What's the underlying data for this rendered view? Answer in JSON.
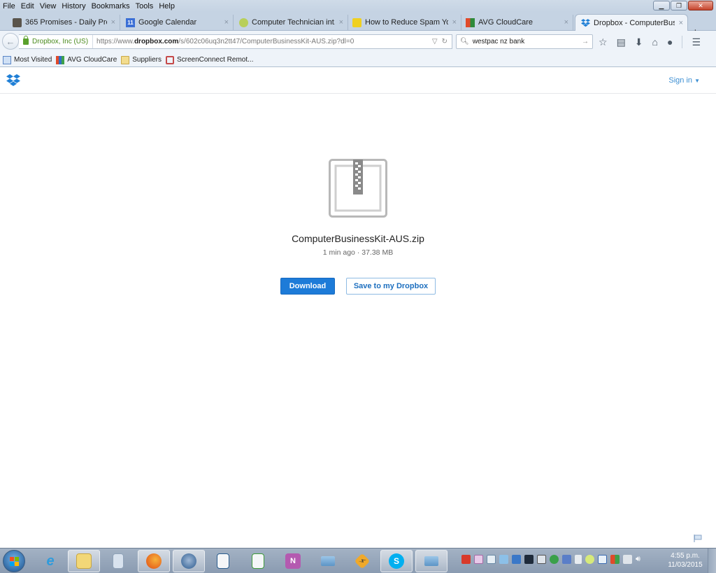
{
  "menubar": {
    "items": [
      "File",
      "Edit",
      "View",
      "History",
      "Bookmarks",
      "Tools",
      "Help"
    ]
  },
  "window_controls": {
    "minimize": "minimize-icon",
    "restore": "restore-icon",
    "close": "close-icon"
  },
  "tabs": [
    {
      "label": "365 Promises - Daily Pro...",
      "icon": "box-icon",
      "active": false
    },
    {
      "label": "Google Calendar",
      "icon": "calendar-icon",
      "icon_text": "11",
      "active": false
    },
    {
      "label": "Computer Technician int...",
      "icon": "mug-icon",
      "active": false
    },
    {
      "label": "How to Reduce Spam Yo...",
      "icon": "cartoon-icon",
      "active": false
    },
    {
      "label": "AVG CloudCare",
      "icon": "avg-icon",
      "active": false
    },
    {
      "label": "Dropbox - ComputerBusi...",
      "icon": "dropbox-icon",
      "active": true
    }
  ],
  "newtab_label": "+",
  "tab_close_glyph": "×",
  "navbar": {
    "identity": "Dropbox, Inc (US)",
    "url_prefix": "https://www.",
    "url_domain": "dropbox.com",
    "url_path": "/s/602c06uq3n2tt47/ComputerBusinessKit-AUS.zip?dl=0",
    "search_value": "westpac nz bank"
  },
  "bookmarks": [
    {
      "label": "Most Visited",
      "icon": "most-visited-icon"
    },
    {
      "label": "AVG CloudCare",
      "icon": "avg-icon"
    },
    {
      "label": "Suppliers",
      "icon": "folder-icon"
    },
    {
      "label": "ScreenConnect Remot...",
      "icon": "screenconnect-icon"
    }
  ],
  "page": {
    "signin_label": "Sign in",
    "file_name": "ComputerBusinessKit-AUS.zip",
    "file_age": "1 min ago",
    "separator": "·",
    "file_size": "37.38 MB",
    "download_label": "Download",
    "save_label": "Save to my Dropbox"
  },
  "colors": {
    "accent": "#1d7bd8",
    "link": "#3d8fd3",
    "secure": "#5aa02c"
  },
  "taskbar": {
    "apps": [
      {
        "name": "internet-explorer",
        "open": false
      },
      {
        "name": "windows-explorer",
        "open": true
      },
      {
        "name": "calculator",
        "open": false
      },
      {
        "name": "firefox",
        "open": true
      },
      {
        "name": "thunderbird",
        "open": true
      },
      {
        "name": "libreoffice-writer",
        "open": false
      },
      {
        "name": "libreoffice-calc",
        "open": false
      },
      {
        "name": "onenote",
        "open": false
      },
      {
        "name": "sketch-tool",
        "open": false
      },
      {
        "name": "winamp",
        "open": false
      },
      {
        "name": "skype",
        "open": true
      },
      {
        "name": "sketch-tool-2",
        "open": true
      }
    ],
    "clock_time": "4:55 p.m.",
    "clock_date": "11/03/2015"
  }
}
